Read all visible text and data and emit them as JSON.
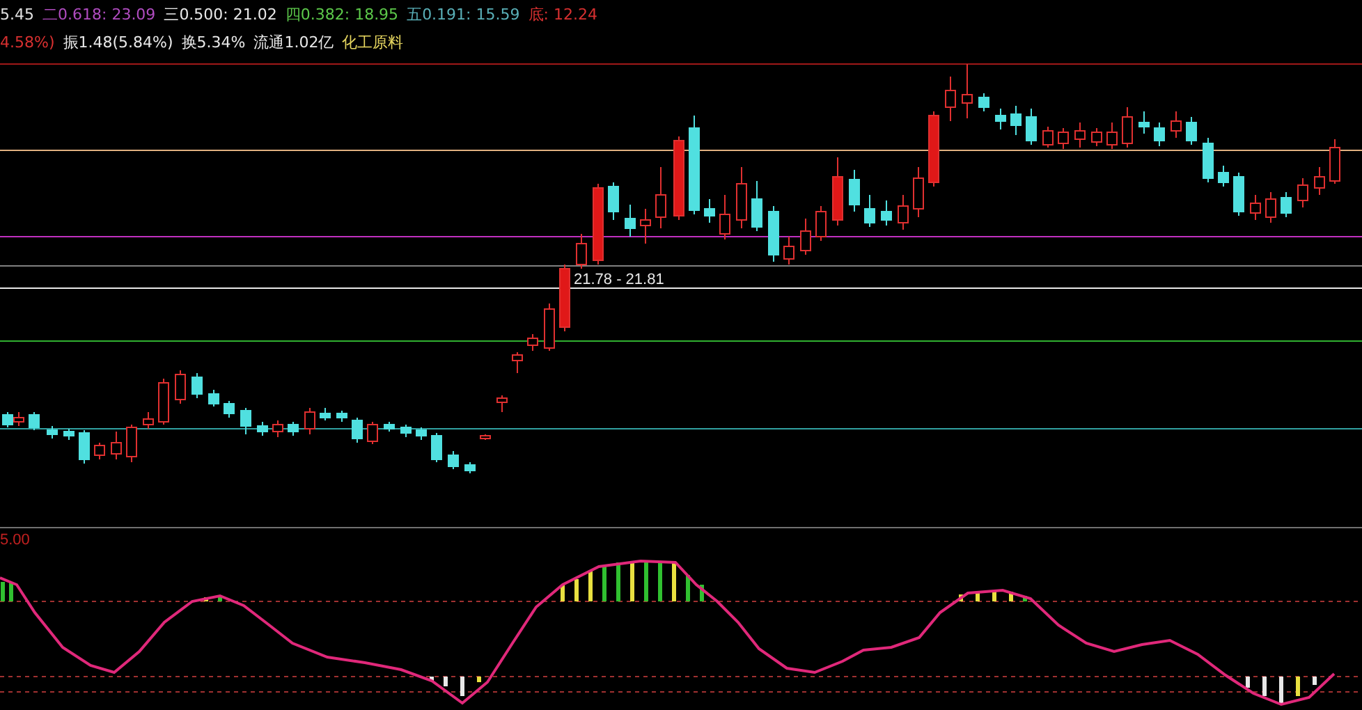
{
  "fib_legend": [
    {
      "text": "5.45",
      "color": "#e0e0e0"
    },
    {
      "text": "二0.618: 23.09",
      "color": "#b04cc0"
    },
    {
      "text": "三0.500: 21.02",
      "color": "#e8e8e8"
    },
    {
      "text": "四0.382: 18.95",
      "color": "#5cc84a"
    },
    {
      "text": "五0.191: 15.59",
      "color": "#5ab0b8"
    },
    {
      "text": "底: 12.24",
      "color": "#d83030"
    }
  ],
  "quote_info": [
    {
      "text": "4.58%)",
      "color": "#d83030"
    },
    {
      "text": "振1.48(5.84%)",
      "color": "#e8e8e8"
    },
    {
      "text": "换5.34%",
      "color": "#e8e8e8"
    },
    {
      "text": "流通1.02亿",
      "color": "#e8e8e8"
    },
    {
      "text": "化工原料",
      "color": "#e8d860"
    }
  ],
  "price_range_label": "21.78 - 21.81",
  "indicator_pane": {
    "label": "5.00"
  }
}
